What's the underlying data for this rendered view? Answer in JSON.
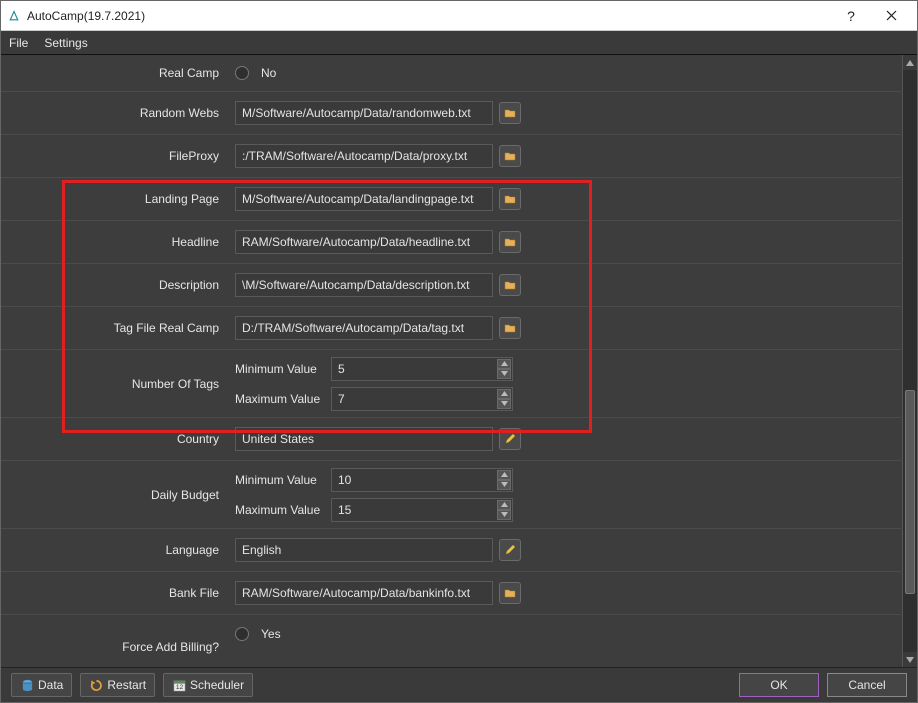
{
  "title": "AutoCamp(19.7.2021)",
  "menu": {
    "file": "File",
    "settings": "Settings"
  },
  "rows": {
    "real_camp": {
      "label": "Real Camp",
      "option": "No"
    },
    "random_webs": {
      "label": "Random Webs",
      "value": "M/Software/Autocamp/Data/randomweb.txt"
    },
    "file_proxy": {
      "label": "FileProxy",
      "value": ":/TRAM/Software/Autocamp/Data/proxy.txt"
    },
    "landing_page": {
      "label": "Landing Page",
      "value": "M/Software/Autocamp/Data/landingpage.txt"
    },
    "headline": {
      "label": "Headline",
      "value": "RAM/Software/Autocamp/Data/headline.txt"
    },
    "description": {
      "label": "Description",
      "value": "\\M/Software/Autocamp/Data/description.txt"
    },
    "tag_file": {
      "label": "Tag File Real Camp",
      "value": "D:/TRAM/Software/Autocamp/Data/tag.txt"
    },
    "num_tags": {
      "label": "Number Of Tags",
      "min_label": "Minimum Value",
      "min": "5",
      "max_label": "Maximum Value",
      "max": "7"
    },
    "country": {
      "label": "Country",
      "value": "United States"
    },
    "daily_budget": {
      "label": "Daily Budget",
      "min_label": "Minimum Value",
      "min": "10",
      "max_label": "Maximum Value",
      "max": "15"
    },
    "language": {
      "label": "Language",
      "value": "English"
    },
    "bank_file": {
      "label": "Bank File",
      "value": "RAM/Software/Autocamp/Data/bankinfo.txt"
    },
    "force_add": {
      "label": "Force Add Billing?",
      "option": "Yes"
    }
  },
  "bottom": {
    "data": "Data",
    "restart": "Restart",
    "scheduler": "Scheduler",
    "ok": "OK",
    "cancel": "Cancel"
  }
}
